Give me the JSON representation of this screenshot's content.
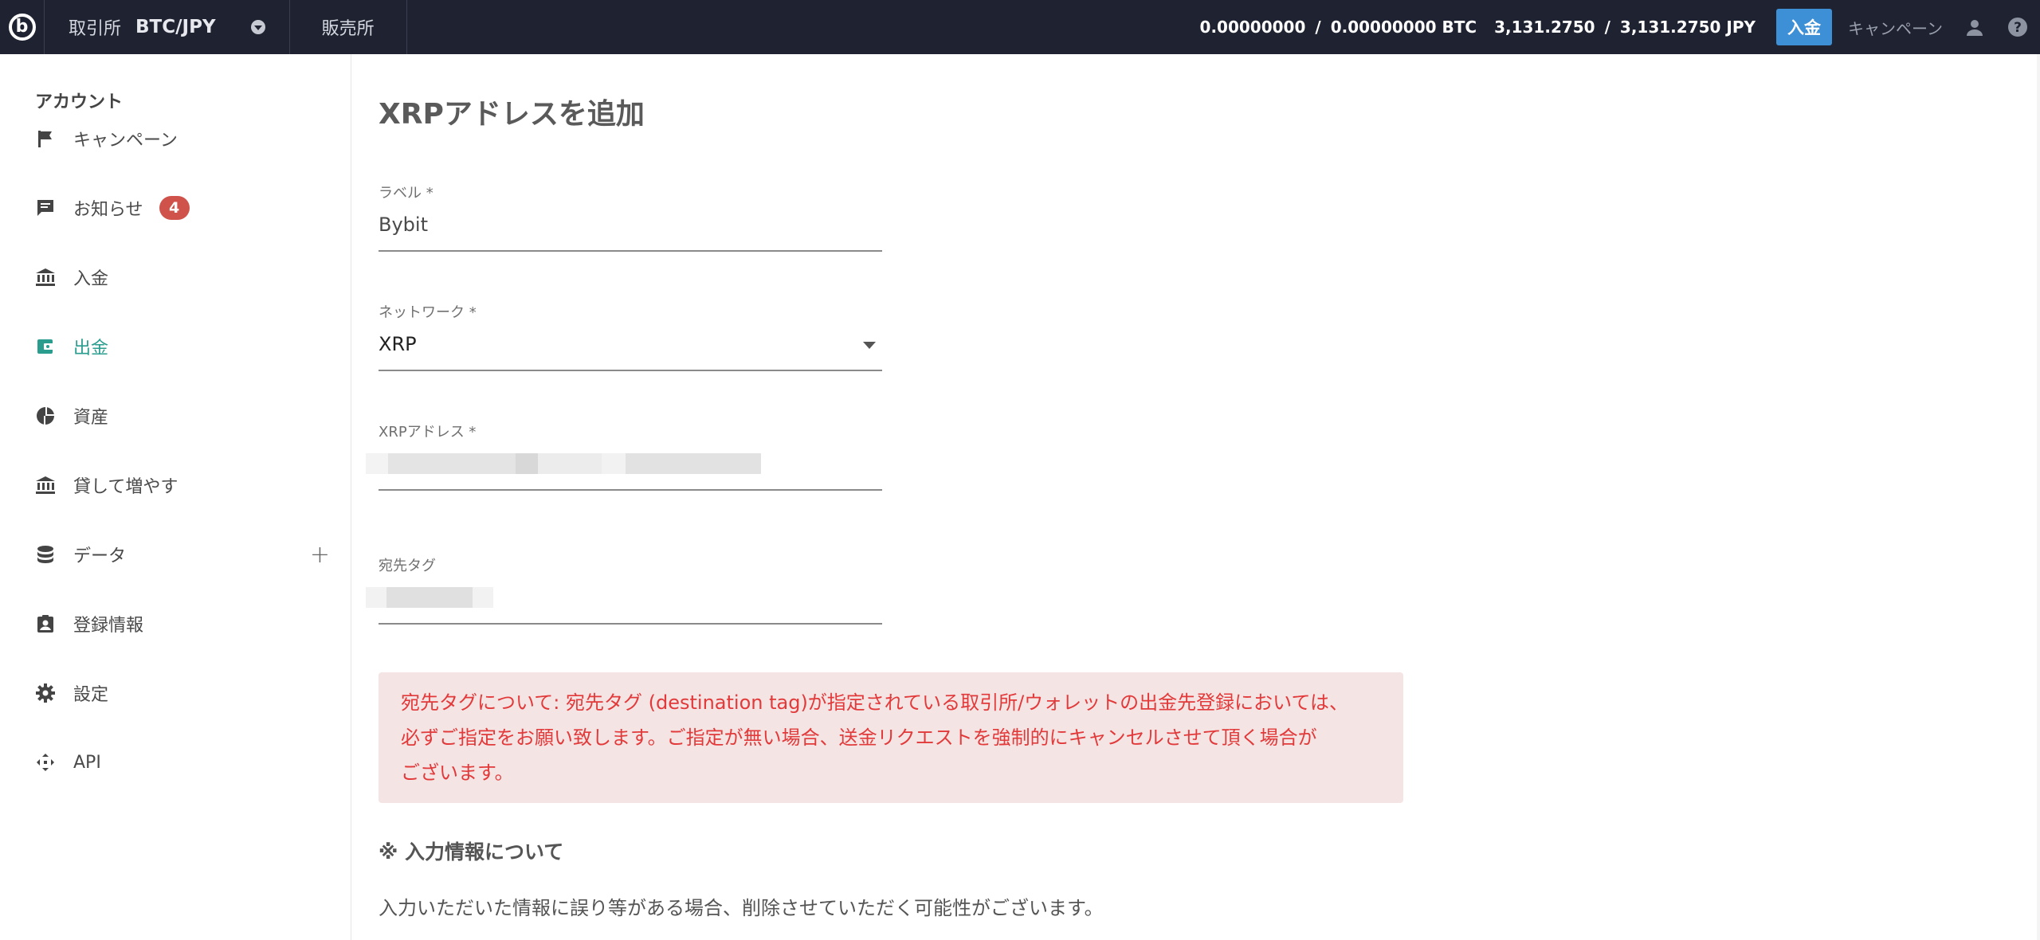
{
  "topbar": {
    "logo": "b",
    "exchange_label": "取引所",
    "pair": "BTC/JPY",
    "store_label": "販売所",
    "btc_available": "0.00000000",
    "btc_total": "0.00000000 BTC",
    "jpy_available": "3,131.2750",
    "jpy_total": "3,131.2750 JPY",
    "separator": "/",
    "deposit_button": "入金",
    "campaign": "キャンペーン",
    "icons": [
      "user-icon",
      "help-icon"
    ]
  },
  "sidebar": {
    "title": "アカウント",
    "items": [
      {
        "label": "キャンペーン",
        "icon": "flag-icon"
      },
      {
        "label": "お知らせ",
        "icon": "message-icon",
        "badge": "4"
      },
      {
        "label": "入金",
        "icon": "bank-icon"
      },
      {
        "label": "出金",
        "icon": "wallet-icon",
        "active": true
      },
      {
        "label": "資産",
        "icon": "pie-chart-icon"
      },
      {
        "label": "貸して増やす",
        "icon": "bank-icon"
      },
      {
        "label": "データ",
        "icon": "database-icon",
        "expand": "+"
      },
      {
        "label": "登録情報",
        "icon": "badge-icon"
      },
      {
        "label": "設定",
        "icon": "gear-icon"
      },
      {
        "label": "API",
        "icon": "api-icon"
      }
    ]
  },
  "main": {
    "title": "XRPアドレスを追加",
    "fields": {
      "label": {
        "label": "ラベル *",
        "value": "Bybit"
      },
      "network": {
        "label": "ネットワーク *",
        "value": "XRP"
      },
      "address": {
        "label": "XRPアドレス *",
        "value": ""
      },
      "tag": {
        "label": "宛先タグ",
        "value": ""
      }
    },
    "alert": {
      "line1": "宛先タグについて: 宛先タグ (destination tag)が指定されている取引所/ウォレットの出金先登録においては、",
      "line2": "必ずご指定をお願い致します。ご指定が無い場合、送金リクエストを強制的にキャンセルさせて頂く場合が",
      "line3": "ございます。"
    },
    "notes_title": "※ 入力情報について",
    "notes_body": "入力いただいた情報に誤り等がある場合、削除させていただく可能性がございます。"
  },
  "colors": {
    "topbar_bg": "#1f2331",
    "accent_blue": "#3d8fd6",
    "active_green": "#2a9d8f",
    "badge_red": "#d0534b",
    "alert_bg": "#f5e4e4",
    "alert_text": "#e23a3a"
  }
}
